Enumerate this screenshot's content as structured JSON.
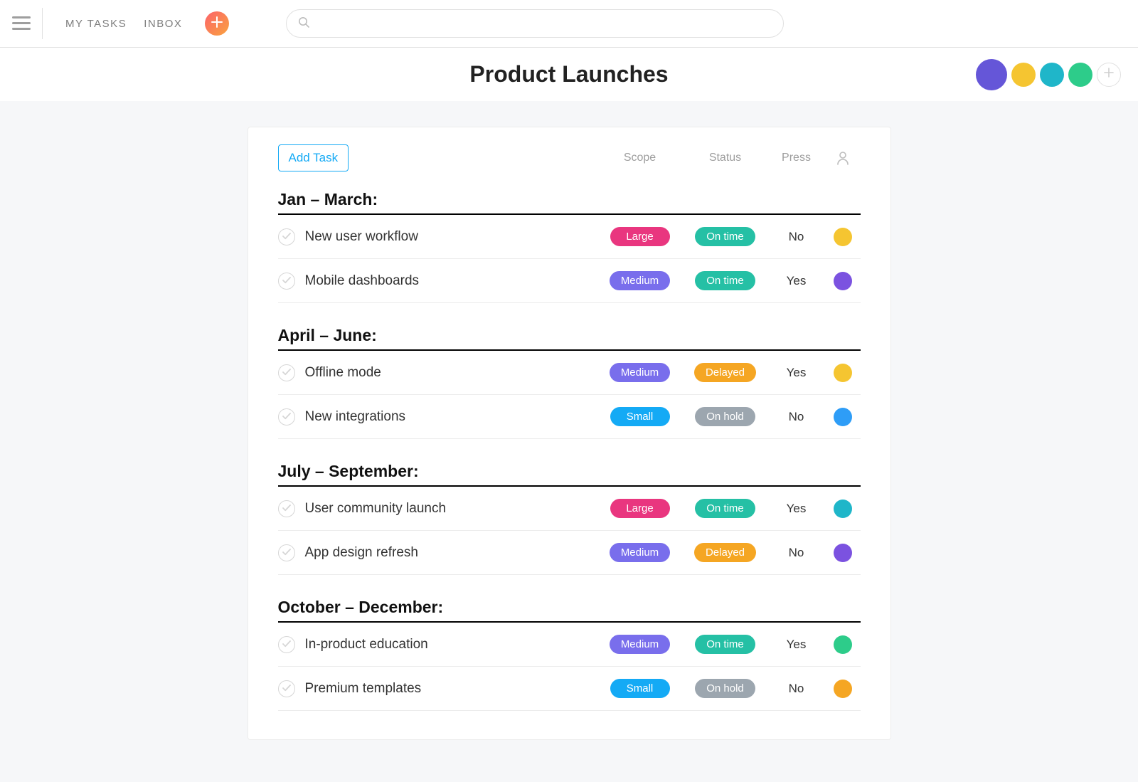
{
  "nav": {
    "my_tasks": "MY TASKS",
    "inbox": "INBOX"
  },
  "search": {
    "placeholder": ""
  },
  "page": {
    "title": "Product Launches"
  },
  "members": [
    {
      "color_class": "av-purple"
    },
    {
      "color_class": "av-yellow"
    },
    {
      "color_class": "av-teal"
    },
    {
      "color_class": "av-green"
    }
  ],
  "card": {
    "add_task_label": "Add Task",
    "columns": {
      "scope": "Scope",
      "status": "Status",
      "press": "Press"
    }
  },
  "scope_colors": {
    "Large": "#e9367f",
    "Medium": "#796EEC",
    "Small": "#14aaf5"
  },
  "status_colors": {
    "On time": "#25c0a5",
    "Delayed": "#f5a623",
    "On hold": "#9ca6af"
  },
  "sections": [
    {
      "title": "Jan – March:",
      "tasks": [
        {
          "name": "New user workflow",
          "scope": "Large",
          "status": "On time",
          "press": "No",
          "avatar_class": "av-yellow"
        },
        {
          "name": "Mobile dashboards",
          "scope": "Medium",
          "status": "On time",
          "press": "Yes",
          "avatar_class": "av-violet"
        }
      ]
    },
    {
      "title": "April – June:",
      "tasks": [
        {
          "name": "Offline mode",
          "scope": "Medium",
          "status": "Delayed",
          "press": "Yes",
          "avatar_class": "av-yellow"
        },
        {
          "name": "New integrations",
          "scope": "Small",
          "status": "On hold",
          "press": "No",
          "avatar_class": "av-blue"
        }
      ]
    },
    {
      "title": "July – September:",
      "tasks": [
        {
          "name": "User community launch",
          "scope": "Large",
          "status": "On time",
          "press": "Yes",
          "avatar_class": "av-teal"
        },
        {
          "name": "App design refresh",
          "scope": "Medium",
          "status": "Delayed",
          "press": "No",
          "avatar_class": "av-violet"
        }
      ]
    },
    {
      "title": "October – December:",
      "tasks": [
        {
          "name": "In-product education",
          "scope": "Medium",
          "status": "On time",
          "press": "Yes",
          "avatar_class": "av-green"
        },
        {
          "name": "Premium templates",
          "scope": "Small",
          "status": "On hold",
          "press": "No",
          "avatar_class": "av-orange"
        }
      ]
    }
  ]
}
